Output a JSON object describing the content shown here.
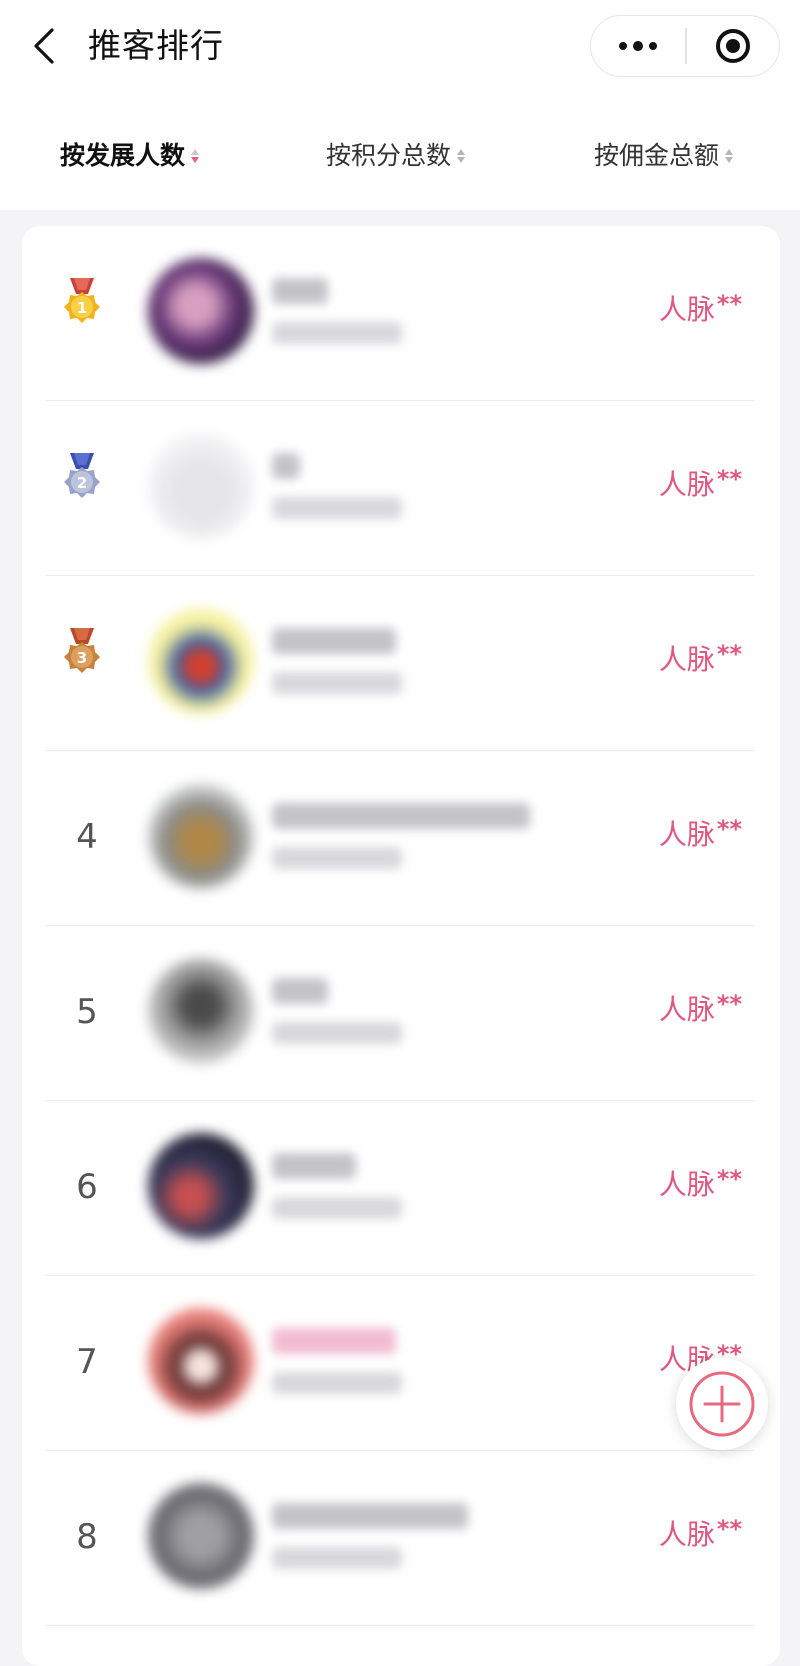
{
  "header": {
    "title": "推客排行",
    "back_icon": "chevron-left-icon",
    "more_icon": "more-dots-icon",
    "target_icon": "target-circle-icon"
  },
  "tabs": [
    {
      "label": "按发展人数",
      "active": true
    },
    {
      "label": "按积分总数",
      "active": false
    },
    {
      "label": "按佣金总额",
      "active": false
    }
  ],
  "accent_color": "#e0577f",
  "ranking": [
    {
      "rank": "1",
      "medal": "gold-medal-icon",
      "contact_label": "人脉",
      "contact_mask": "**"
    },
    {
      "rank": "2",
      "medal": "silver-medal-icon",
      "contact_label": "人脉",
      "contact_mask": "**"
    },
    {
      "rank": "3",
      "medal": "bronze-medal-icon",
      "contact_label": "人脉",
      "contact_mask": "**"
    },
    {
      "rank": "4",
      "contact_label": "人脉",
      "contact_mask": "**"
    },
    {
      "rank": "5",
      "contact_label": "人脉",
      "contact_mask": "**"
    },
    {
      "rank": "6",
      "contact_label": "人脉",
      "contact_mask": "**"
    },
    {
      "rank": "7",
      "contact_label": "人脉",
      "contact_mask": "**"
    },
    {
      "rank": "8",
      "contact_label": "人脉",
      "contact_mask": "**"
    }
  ],
  "fab_icon": "plus-circle-icon"
}
